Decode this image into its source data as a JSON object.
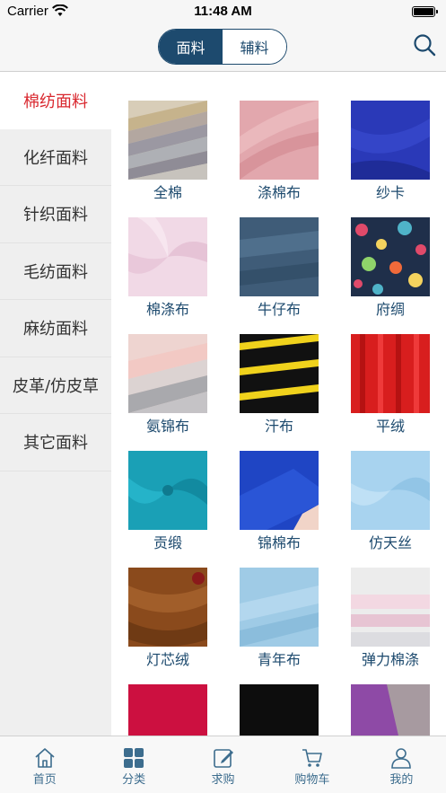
{
  "status_bar": {
    "carrier": "Carrier",
    "time": "11:48 AM"
  },
  "nav": {
    "segments": [
      "面料",
      "辅料"
    ],
    "active_segment": 0,
    "colors": {
      "primary": "#1d4a6e",
      "accent_red": "#d9282f"
    }
  },
  "sidebar": {
    "items": [
      "棉纺面料",
      "化纤面料",
      "针织面料",
      "毛纺面料",
      "麻纺面料",
      "皮革/仿皮草",
      "其它面料"
    ],
    "active_index": 0
  },
  "grid": {
    "items": [
      {
        "label": "全棉",
        "image": "beige-grey-fabric-stack"
      },
      {
        "label": "涤棉布",
        "image": "pink-diagonal-fabric"
      },
      {
        "label": "纱卡",
        "image": "royal-blue-fabric"
      },
      {
        "label": "棉涤布",
        "image": "light-pink-swirl-fabric"
      },
      {
        "label": "牛仔布",
        "image": "denim-fabric"
      },
      {
        "label": "府绸",
        "image": "floral-print-fabric"
      },
      {
        "label": "氨锦布",
        "image": "pastel-pink-grey-stack"
      },
      {
        "label": "汗布",
        "image": "black-yellow-stripe-fabric"
      },
      {
        "label": "平绒",
        "image": "red-velvet-fabric"
      },
      {
        "label": "贡缎",
        "image": "teal-swirl-fabric"
      },
      {
        "label": "锦棉布",
        "image": "cobalt-folded-fabric"
      },
      {
        "label": "仿天丝",
        "image": "light-blue-swirl-fabric"
      },
      {
        "label": "灯芯绒",
        "image": "brown-corduroy-fabric"
      },
      {
        "label": "青年布",
        "image": "light-blue-dot-fabric"
      },
      {
        "label": "弹力棉涤",
        "image": "white-pink-stack-fabric"
      },
      {
        "label": "",
        "image": "crimson-fabric"
      },
      {
        "label": "",
        "image": "black-fabric"
      },
      {
        "label": "",
        "image": "purple-grey-jacquard-fabric"
      }
    ]
  },
  "tab_bar": {
    "tabs": [
      {
        "label": "首页",
        "icon": "home-icon"
      },
      {
        "label": "分类",
        "icon": "category-grid-icon"
      },
      {
        "label": "求购",
        "icon": "edit-note-icon"
      },
      {
        "label": "购物车",
        "icon": "shopping-cart-icon"
      },
      {
        "label": "我的",
        "icon": "user-icon"
      }
    ]
  }
}
